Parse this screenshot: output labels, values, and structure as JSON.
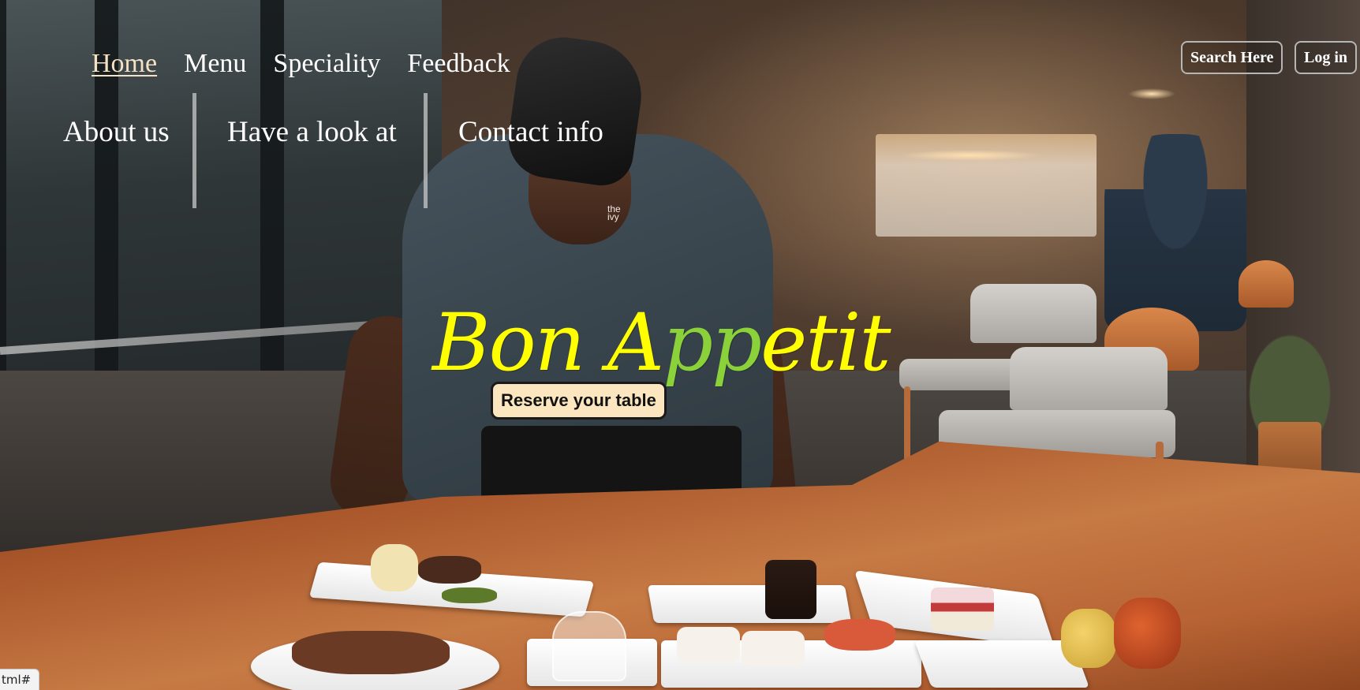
{
  "nav": {
    "primary": [
      {
        "label": "Home",
        "active": true
      },
      {
        "label": "Menu",
        "active": false
      },
      {
        "label": "Speciality",
        "active": false
      },
      {
        "label": "Feedback",
        "active": false
      }
    ],
    "secondary": [
      {
        "label": "About us"
      },
      {
        "label": "Have a look at"
      },
      {
        "label": "Contact info"
      }
    ]
  },
  "header_buttons": {
    "search": "Search Here",
    "login": "Log in"
  },
  "hero": {
    "title_part1": "Bon A",
    "title_accent": "pp",
    "title_part2": "etit",
    "reserve_button": "Reserve your table"
  },
  "chef_logo": {
    "line1": "the",
    "line2": "ivy"
  },
  "status_bar": {
    "url": "tml#"
  },
  "colors": {
    "title": "#ffff00",
    "title_accent": "#8ad13a",
    "reserve_bg": "#fbe6bf",
    "active_link": "#f5e1c4"
  }
}
